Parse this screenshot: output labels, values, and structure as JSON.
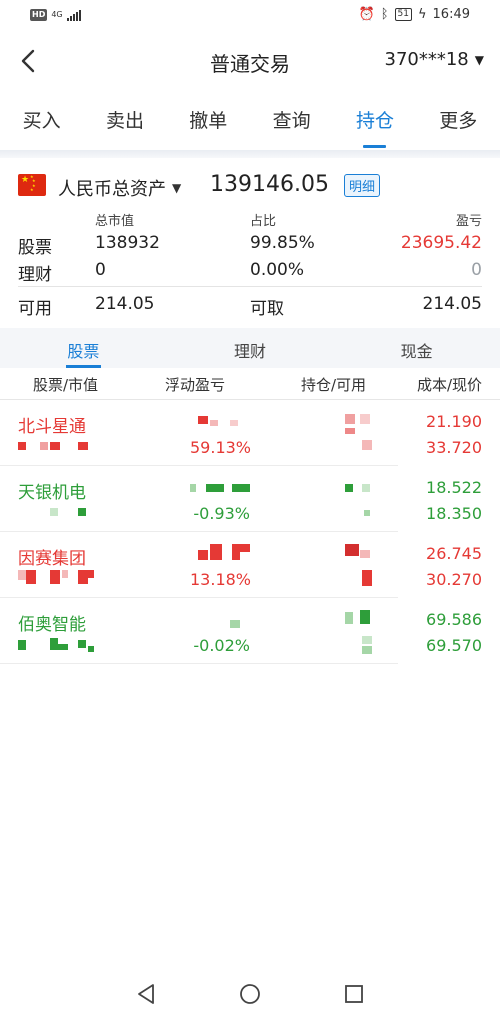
{
  "status_bar": {
    "hd_badge": "HD",
    "network": "4G",
    "time": "16:49",
    "battery": "51"
  },
  "nav": {
    "title": "普通交易",
    "account": "370***18"
  },
  "tabs": [
    {
      "label": "买入"
    },
    {
      "label": "卖出"
    },
    {
      "label": "撤单"
    },
    {
      "label": "查询"
    },
    {
      "label": "持仓",
      "active": true
    },
    {
      "label": "更多"
    }
  ],
  "summary": {
    "asset_label": "人民币总资产",
    "total_assets": "139146.05",
    "detail_button": "明细",
    "headers": {
      "market_value": "总市值",
      "ratio": "占比",
      "pnl": "盈亏"
    },
    "stocks": {
      "label": "股票",
      "market_value": "138932",
      "ratio": "99.85%",
      "pnl": "23695.42"
    },
    "wealth": {
      "label": "理财",
      "market_value": "0",
      "ratio": "0.00%",
      "pnl": "0"
    },
    "available_label": "可用",
    "available_value": "214.05",
    "withdrawable_label": "可取",
    "withdrawable_value": "214.05"
  },
  "sub_tabs": [
    {
      "label": "股票",
      "active": true
    },
    {
      "label": "理财"
    },
    {
      "label": "现金"
    }
  ],
  "columns": {
    "stock": "股票/市值",
    "floating_pnl": "浮动盈亏",
    "holding": "持仓/可用",
    "cost": "成本/现价"
  },
  "positions": [
    {
      "name": "北斗星通",
      "pnl_pct": "59.13%",
      "cost": "21.190",
      "price": "33.720",
      "trend": "up"
    },
    {
      "name": "天银机电",
      "pnl_pct": "-0.93%",
      "cost": "18.522",
      "price": "18.350",
      "trend": "down"
    },
    {
      "name": "因赛集团",
      "pnl_pct": "13.18%",
      "cost": "26.745",
      "price": "30.270",
      "trend": "up"
    },
    {
      "name": "佰奥智能",
      "pnl_pct": "-0.02%",
      "cost": "69.586",
      "price": "69.570",
      "trend": "down"
    }
  ],
  "colors": {
    "accent": "#1a7fd6",
    "up": "#e53935",
    "down": "#2e9e3a"
  }
}
